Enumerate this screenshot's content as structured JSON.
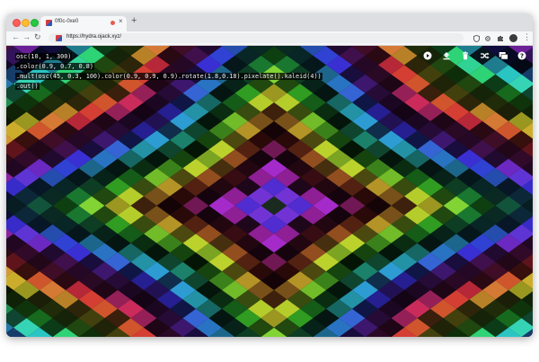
{
  "browser": {
    "tab": {
      "title": "0f0c-0xe0"
    },
    "new_tab": "+",
    "url": "https://hydra.ojack.xyz/"
  },
  "editor": {
    "lines": [
      "osc(10, 1, 300)",
      ".color(0.9, 0.7, 0.8)",
      ".mult(osc(45, 0.3, 100).color(0.9, 0.9, 0.9).rotate(1.8,0.18).pixelate().kaleid(4))",
      ".out()"
    ]
  },
  "toolbar_icons": [
    "run-icon",
    "upload-icon",
    "trash-icon",
    "shuffle-icon",
    "gallery-icon",
    "help-icon"
  ],
  "colors": {
    "window_frame": "#dcdee2",
    "visual_palette": [
      "#2a6ad8",
      "#d53a2b",
      "#e8883a",
      "#c8b048",
      "#7ab05a",
      "#3ea08a",
      "#5a2a9a",
      "#1a1a2a"
    ]
  }
}
